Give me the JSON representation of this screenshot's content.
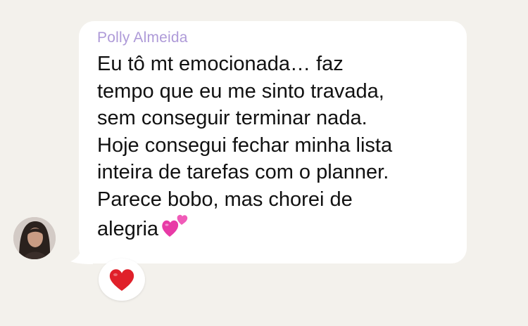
{
  "message": {
    "sender_name": "Polly Almeida",
    "text": "Eu tô mt emocionada… faz\ntempo que eu me sinto travada,\nsem conseguir terminar nada.\nHoje consegui fechar minha lista\ninteira de tarefas com o planner.\nParece bobo, mas chorei de\nalegria",
    "trailing_emoji": "two-hearts-icon",
    "reaction": "red-heart-icon"
  },
  "colors": {
    "background": "#f3f1ec",
    "bubble": "#ffffff",
    "sender_name": "#ae9ad8",
    "text": "#111111",
    "heart": "#e0202a",
    "two_hearts": "#e83aa6"
  }
}
